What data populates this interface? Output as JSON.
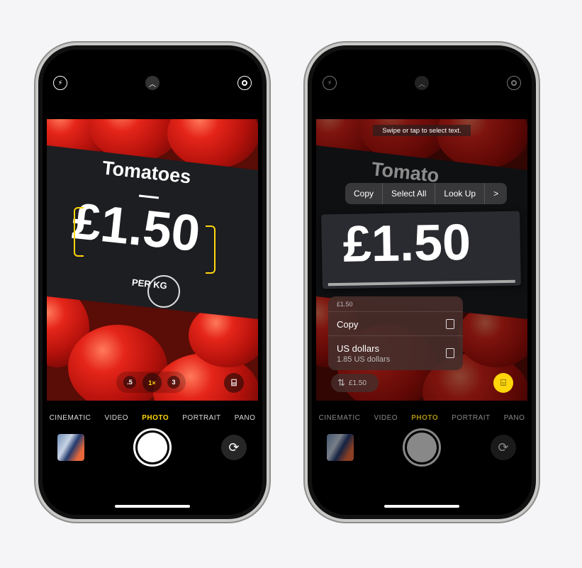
{
  "phone_left": {
    "price_sign": {
      "product": "Tomatoes",
      "price": "£1.50",
      "unit": "PER KG"
    },
    "zoom_levels": [
      ".5",
      "1×",
      "3"
    ],
    "active_zoom": "1×",
    "modes": [
      "CINEMATIC",
      "VIDEO",
      "PHOTO",
      "PORTRAIT",
      "PANO"
    ],
    "active_mode": "PHOTO",
    "icons": {
      "flash": "flash-icon",
      "chevron": "chevron-up-icon",
      "live": "live-photo-icon",
      "live_text": "live-text-icon",
      "flip": "camera-flip-icon"
    }
  },
  "phone_right": {
    "hint": "Swipe or tap to select text.",
    "price_sign": {
      "product": "Tomato",
      "price": "£1.50"
    },
    "edit_menu": [
      "Copy",
      "Select All",
      "Look Up",
      ">"
    ],
    "popup": {
      "header": "£1.50",
      "copy_label": "Copy",
      "conversion_label": "US dollars",
      "conversion_value": "1.85 US dollars"
    },
    "chip_label": "£1.50",
    "modes": [
      "CINEMATIC",
      "VIDEO",
      "PHOTO",
      "PORTRAIT",
      "PANO"
    ],
    "active_mode": "PHOTO",
    "accent": "#ffd60a"
  }
}
